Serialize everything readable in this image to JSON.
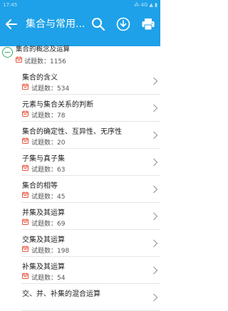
{
  "status_bar": {
    "time": "17:45",
    "right": "⁂ 4G ▲ ▮"
  },
  "toolbar": {
    "title": "集合与常用...",
    "back_icon": "arrow-left-icon",
    "search_icon": "search-icon",
    "download_icon": "download-circle-icon",
    "print_icon": "printer-icon",
    "background": "#1ea1e8"
  },
  "group": {
    "title": "集合的概念及运算",
    "count": "试题数：1156",
    "collapse_icon": "minus-circle-icon",
    "accent": "#37a86b"
  },
  "items": [
    {
      "title": "集合的含义",
      "count": "试题数：534"
    },
    {
      "title": "元素与集合关系的判断",
      "count": "试题数：78"
    },
    {
      "title": "集合的确定性、互异性、无序性",
      "count": "试题数：20"
    },
    {
      "title": "子集与真子集",
      "count": "试题数：63"
    },
    {
      "title": "集合的相等",
      "count": "试题数：45"
    },
    {
      "title": "并集及其运算",
      "count": "试题数：69"
    },
    {
      "title": "交集及其运算",
      "count": "试题数：198"
    },
    {
      "title": "补集及其运算",
      "count": "试题数：54"
    },
    {
      "title": "交、并、补集的混合运算",
      "count": ""
    }
  ],
  "icon_color": "#e8533d"
}
